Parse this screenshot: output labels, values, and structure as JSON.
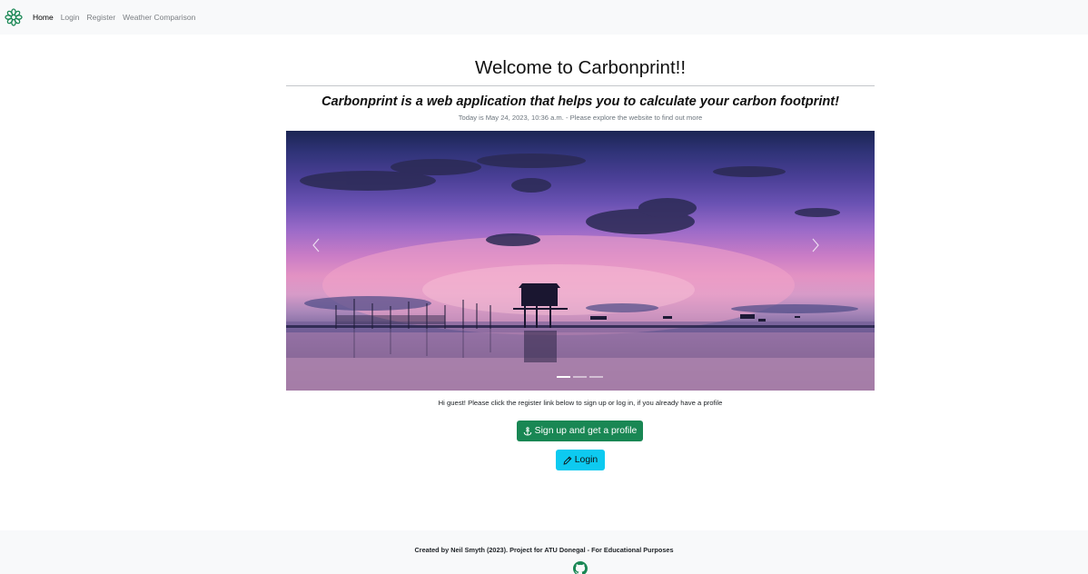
{
  "nav": {
    "items": [
      {
        "label": "Home",
        "active": true
      },
      {
        "label": "Login",
        "active": false
      },
      {
        "label": "Register",
        "active": false
      },
      {
        "label": "Weather Comparison",
        "active": false
      }
    ],
    "brand_icon": "green-flower-logo",
    "brand_color": "#198754"
  },
  "main": {
    "title": "Welcome to Carbonprint!!",
    "subtitle": "Carbonprint is a web application that helps you to calculate your carbon footprint!",
    "date_line": "Today is May 24, 2023, 10:36 a.m. - Please explore the website to find out more"
  },
  "carousel": {
    "slide_description": "sunset seascape with stilt house",
    "prev_icon": "chevron-left-icon",
    "next_icon": "chevron-right-icon",
    "slide_count": 3,
    "active_slide": 1
  },
  "guest": {
    "message": "Hi guest! Please click the register link below to sign up or log in, if you already have a profile"
  },
  "buttons": {
    "signup_label": "Sign up and get a profile",
    "signup_icon": "anchor-icon",
    "signup_color": "#198754",
    "login_label": "Login",
    "login_icon": "pencil-icon",
    "login_color": "#0dcaf0"
  },
  "footer": {
    "text": "Created by Neil Smyth (2023). Project for ATU Donegal - For Educational Purposes",
    "icon": "github-icon",
    "icon_color": "#198754"
  }
}
